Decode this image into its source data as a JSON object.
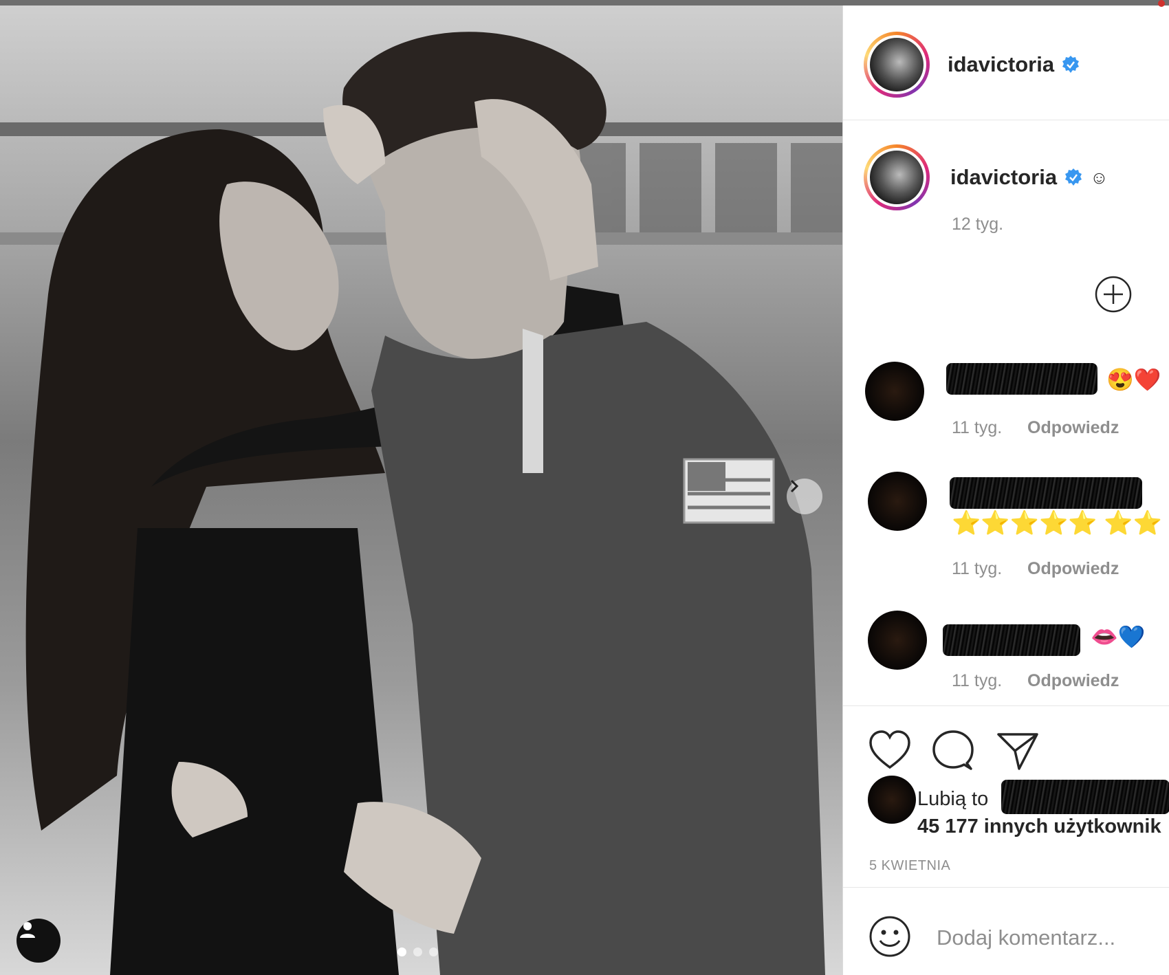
{
  "post": {
    "username": "idavictoria",
    "verified": true,
    "caption_emoji": "☺",
    "caption_time": "12 tyg.",
    "carousel": {
      "total": 3,
      "active": 1
    }
  },
  "comments": [
    {
      "emojis": "😍❤️",
      "time": "11 tyg.",
      "reply": "Odpowiedz"
    },
    {
      "emojis": "⭐⭐⭐⭐⭐ ⭐⭐",
      "time": "11 tyg.",
      "reply": "Odpowiedz"
    },
    {
      "emojis": "👄💙",
      "time": "11 tyg.",
      "reply": "Odpowiedz"
    }
  ],
  "likes": {
    "prefix": "Lubią to",
    "count_text": "45 177 innych użytkownik"
  },
  "date": "5 KWIETNIA",
  "add_comment_placeholder": "Dodaj komentarz...",
  "colors": {
    "verified": "#3897f0",
    "secondary_text": "#8e8e8e",
    "primary_text": "#262626"
  },
  "icons": [
    "heart-icon",
    "comment-icon",
    "share-icon",
    "smile-icon",
    "plus-circle-icon",
    "chevron-right-icon",
    "user-tag-icon",
    "verified-icon"
  ]
}
